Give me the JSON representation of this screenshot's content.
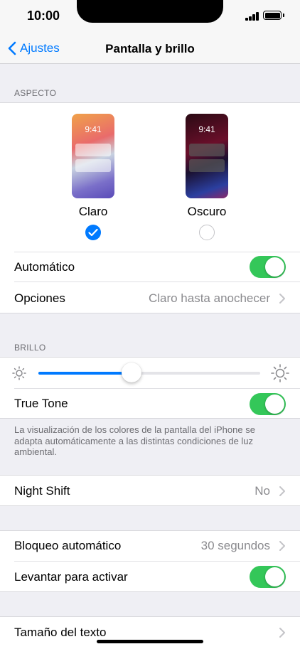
{
  "status_bar": {
    "time": "10:00"
  },
  "nav": {
    "back_label": "Ajustes",
    "title": "Pantalla y brillo"
  },
  "appearance": {
    "header": "ASPECTO",
    "light": {
      "preview_time": "9:41",
      "label": "Claro",
      "selected": true
    },
    "dark": {
      "preview_time": "9:41",
      "label": "Oscuro",
      "selected": false
    },
    "automatic_label": "Automático",
    "automatic_on": true,
    "options_label": "Opciones",
    "options_value": "Claro hasta anochecer"
  },
  "brightness": {
    "header": "BRILLO",
    "level_percent": 42,
    "true_tone_label": "True Tone",
    "true_tone_on": true,
    "footer": "La visualización de los colores de la pantalla del iPhone se adapta automáticamente a las distintas condiciones de luz ambiental."
  },
  "night_shift": {
    "label": "Night Shift",
    "value": "No"
  },
  "lock": {
    "auto_lock_label": "Bloqueo automático",
    "auto_lock_value": "30 segundos",
    "raise_to_wake_label": "Levantar para activar",
    "raise_to_wake_on": true
  },
  "text": {
    "text_size_label": "Tamaño del texto"
  },
  "colors": {
    "accent": "#007aff",
    "toggle_on": "#34c759"
  }
}
